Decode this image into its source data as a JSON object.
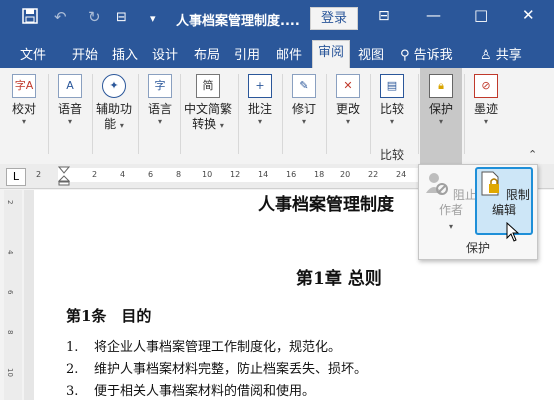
{
  "titlebar": {
    "title": "人事档案管理制度....",
    "login_label": "登录",
    "minimize": "—",
    "restore": "□",
    "close": "✕",
    "save_icon": "save-icon",
    "undo_icon": "undo-icon",
    "redo_icon": "redo-icon"
  },
  "tabs": [
    {
      "label": "文件"
    },
    {
      "label": "开始"
    },
    {
      "label": "插入"
    },
    {
      "label": "设计"
    },
    {
      "label": "布局"
    },
    {
      "label": "引用"
    },
    {
      "label": "邮件"
    },
    {
      "label": "审阅"
    },
    {
      "label": "视图"
    },
    {
      "label": "告诉我"
    },
    {
      "label": "共享"
    }
  ],
  "ribbon": {
    "buttons": [
      {
        "label": "校对",
        "icon": "proofing-icon"
      },
      {
        "label": "语音",
        "icon": "speech-icon"
      },
      {
        "label": "辅助功",
        "label2": "能",
        "icon": "accessibility-icon"
      },
      {
        "label": "语言",
        "icon": "language-icon"
      },
      {
        "label": "中文简繁",
        "label2": "转换",
        "icon": "chinese-conversion-icon"
      },
      {
        "label": "批注",
        "icon": "comment-icon"
      },
      {
        "label": "修订",
        "icon": "track-changes-icon"
      },
      {
        "label": "更改",
        "icon": "changes-icon"
      },
      {
        "label": "比较",
        "icon": "compare-icon"
      },
      {
        "label": "保护",
        "icon": "protect-icon"
      },
      {
        "label": "墨迹",
        "icon": "ink-icon"
      }
    ],
    "compare_group_label": "比较"
  },
  "ruler": {
    "corner": "L",
    "ticks": [
      "2",
      "2",
      "4",
      "6",
      "8",
      "10",
      "12",
      "14",
      "16",
      "18",
      "20",
      "22",
      "24",
      "26"
    ],
    "vticks": [
      "2",
      "4",
      "6",
      "8",
      "10"
    ]
  },
  "protect_panel": {
    "block_authors": "阻止作者",
    "restrict_editing": "限制编辑",
    "group_label": "保护"
  },
  "document": {
    "header": "人事档案管理制度",
    "chapter": "第1章 总则",
    "article": "第1条　目的",
    "items": [
      {
        "num": "1.",
        "text": "将企业人事档案管理工作制度化，规范化。"
      },
      {
        "num": "2.",
        "text": "维护人事档案材料完整，防止档案丢失、损坏。"
      },
      {
        "num": "3.",
        "text": "便于相关人事档案材料的借阅和使用。"
      }
    ]
  }
}
